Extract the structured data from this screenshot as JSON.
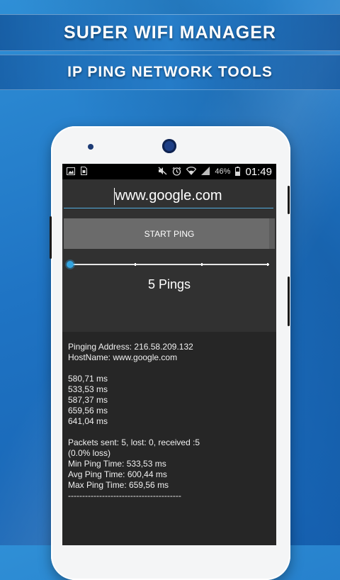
{
  "banner": {
    "title": "SUPER WIFI MANAGER",
    "subtitle": "IP PING NETWORK TOOLS"
  },
  "status_bar": {
    "left_icons": [
      "image-icon",
      "sim-icon"
    ],
    "right_icons": [
      "mute-icon",
      "alarm-icon",
      "wifi-icon",
      "signal-icon",
      "battery-icon"
    ],
    "battery": "46%",
    "time": "01:49"
  },
  "url_input": {
    "value": "www.google.com"
  },
  "start_button": {
    "label": "START PING"
  },
  "ping_slider": {
    "value": 0,
    "ticks": 4
  },
  "ping_count_label": "5 Pings",
  "results": {
    "address_line": "Pinging Address: 216.58.209.132",
    "hostname_line": "HostName: www.google.com",
    "times": [
      "580,71 ms",
      "533,53 ms",
      "587,37 ms",
      "659,56 ms",
      "641,04 ms"
    ],
    "packets_line": "Packets sent: 5, lost: 0, received :5",
    "loss_line": "(0.0% loss)",
    "min_line": "Min Ping Time: 533,53 ms",
    "avg_line": "Avg Ping Time: 600,44 ms",
    "max_line": "Max Ping Time: 659,56 ms",
    "divider": "----------------------------------------"
  },
  "colors": {
    "accent": "#33a4e0",
    "screen_bg": "#313131",
    "button_bg": "#6b6b6b"
  }
}
